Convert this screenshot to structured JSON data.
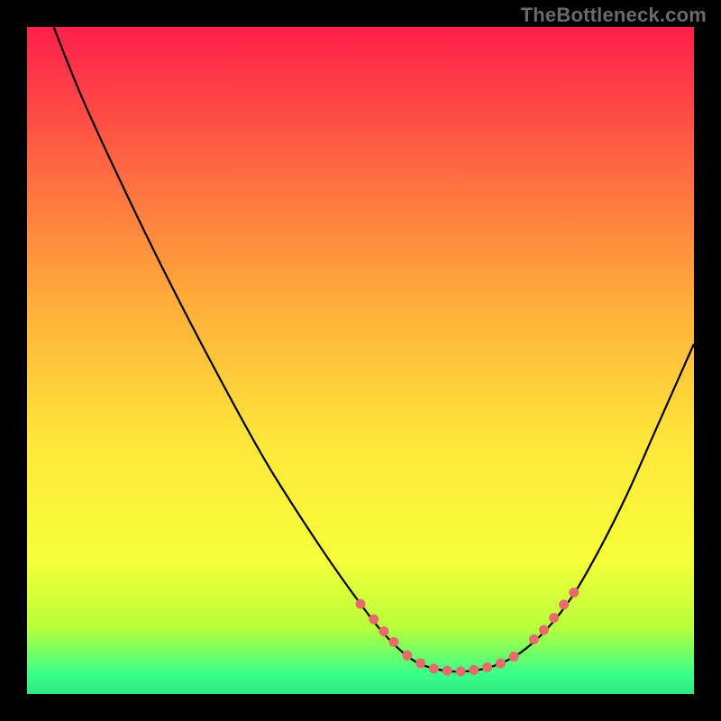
{
  "watermark": "TheBottleneck.com",
  "chart_data": {
    "type": "line",
    "title": "",
    "xlabel": "",
    "ylabel": "",
    "xlim": [
      0,
      100
    ],
    "ylim": [
      0,
      100
    ],
    "grid": false,
    "legend": false,
    "gradient_stops": [
      {
        "offset": 0.0,
        "color": "#ff1f4b"
      },
      {
        "offset": 0.4,
        "color": "#ffa93a"
      },
      {
        "offset": 0.62,
        "color": "#ffe63a"
      },
      {
        "offset": 0.8,
        "color": "#f6ff3a"
      },
      {
        "offset": 0.9,
        "color": "#b8ff3a"
      },
      {
        "offset": 0.97,
        "color": "#3aff8a"
      },
      {
        "offset": 1.0,
        "color": "#2fe77e"
      }
    ],
    "curve": {
      "name": "bottleneck-curve",
      "color": "#000000",
      "points": [
        {
          "x": 4.0,
          "y": 100.0
        },
        {
          "x": 8.0,
          "y": 90.0
        },
        {
          "x": 13.0,
          "y": 79.0
        },
        {
          "x": 20.0,
          "y": 64.5
        },
        {
          "x": 28.0,
          "y": 49.0
        },
        {
          "x": 36.0,
          "y": 34.5
        },
        {
          "x": 44.0,
          "y": 22.0
        },
        {
          "x": 50.0,
          "y": 13.5
        },
        {
          "x": 54.0,
          "y": 8.5
        },
        {
          "x": 58.0,
          "y": 5.0
        },
        {
          "x": 62.0,
          "y": 3.6
        },
        {
          "x": 66.0,
          "y": 3.4
        },
        {
          "x": 70.0,
          "y": 4.2
        },
        {
          "x": 74.0,
          "y": 6.2
        },
        {
          "x": 78.0,
          "y": 9.8
        },
        {
          "x": 82.0,
          "y": 15.0
        },
        {
          "x": 86.0,
          "y": 22.0
        },
        {
          "x": 90.0,
          "y": 30.0
        },
        {
          "x": 94.0,
          "y": 39.0
        },
        {
          "x": 98.0,
          "y": 48.0
        },
        {
          "x": 100.0,
          "y": 52.5
        }
      ]
    },
    "markers": {
      "name": "highlight-points",
      "color": "#e86b6b",
      "radius": 5.5,
      "points": [
        {
          "x": 50.0,
          "y": 13.5
        },
        {
          "x": 52.0,
          "y": 11.2
        },
        {
          "x": 53.5,
          "y": 9.4
        },
        {
          "x": 55.0,
          "y": 7.8
        },
        {
          "x": 57.0,
          "y": 5.8
        },
        {
          "x": 59.0,
          "y": 4.6
        },
        {
          "x": 61.0,
          "y": 3.8
        },
        {
          "x": 63.0,
          "y": 3.5
        },
        {
          "x": 65.0,
          "y": 3.4
        },
        {
          "x": 67.0,
          "y": 3.6
        },
        {
          "x": 69.0,
          "y": 4.0
        },
        {
          "x": 71.0,
          "y": 4.6
        },
        {
          "x": 73.0,
          "y": 5.6
        },
        {
          "x": 76.0,
          "y": 8.2
        },
        {
          "x": 77.5,
          "y": 9.6
        },
        {
          "x": 79.0,
          "y": 11.4
        },
        {
          "x": 80.5,
          "y": 13.4
        },
        {
          "x": 82.0,
          "y": 15.2
        }
      ]
    }
  }
}
